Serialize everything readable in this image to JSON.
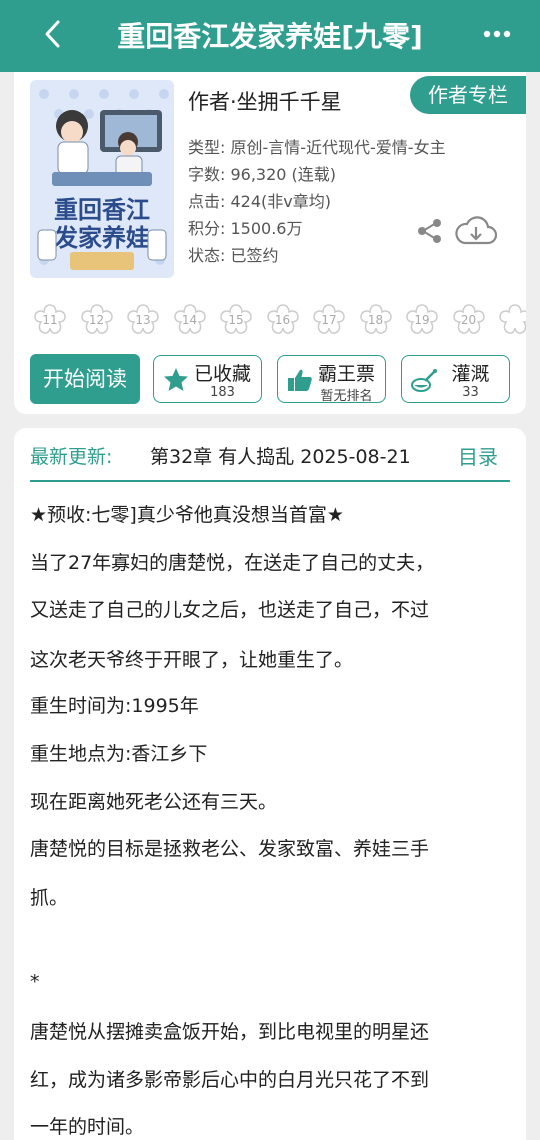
{
  "header": {
    "title": "重回香江发家养娃[九零]"
  },
  "book": {
    "author": "作者·坐拥千千星",
    "author_column_label": "作者专栏",
    "type": "类型: 原创-言情-近代现代-爱情-女主",
    "word_count": "字数: 96,320 (连载)",
    "clicks": "点击: 424(非v章均)",
    "points": "积分: 1500.6万",
    "status": "状态: 已签约",
    "cover_title_lines": [
      "重回香江",
      "发家养娃"
    ]
  },
  "flowers": [
    "11",
    "12",
    "13",
    "14",
    "15",
    "16",
    "17",
    "18",
    "19",
    "20"
  ],
  "actions": {
    "read_label": "开始阅读",
    "collect_label": "已收藏",
    "collect_count": "183",
    "ticket_label": "霸王票",
    "ticket_sub": "暂无排名",
    "water_label": "灌溉",
    "water_count": "33"
  },
  "update": {
    "label": "最新更新:",
    "text": "第32章  有人捣乱  2025-08-21",
    "toc_label": "目录"
  },
  "description": [
    "★预收:七零]真少爷他真没想当首富★",
    "当了27年寡妇的唐楚悦，在送走了自己的丈夫，",
    "又送走了自己的儿女之后，也送走了自己，不过",
    "这次老天爷终于开眼了，让她重生了。",
    "重生时间为:1995年",
    "重生地点为:香江乡下",
    "现在距离她死老公还有三天。",
    "唐楚悦的目标是拯救老公、发家致富、养娃三手",
    "抓。",
    "*",
    "唐楚悦从摆摊卖盒饭开始，到比电视里的明星还",
    "红，成为诸多影帝影后心中的白月光只花了不到",
    "一年的时间。"
  ],
  "colors": {
    "accent": "#2f9e8f",
    "background": "#eeeeee"
  }
}
